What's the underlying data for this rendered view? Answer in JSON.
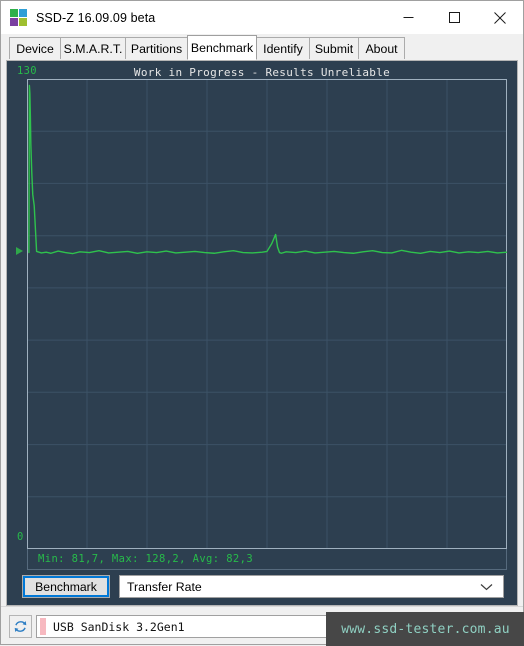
{
  "window": {
    "title": "SSD-Z 16.09.09 beta",
    "icon_name": "ssdz-app-icon",
    "icon_colors": [
      "#2fb04a",
      "#2f9fd6",
      "#7a3fa0",
      "#9fbf2f"
    ],
    "controls": {
      "minimize": "minimize-icon",
      "maximize": "maximize-icon",
      "close": "close-icon"
    }
  },
  "tabs": [
    {
      "label": "Device",
      "active": false
    },
    {
      "label": "S.M.A.R.T.",
      "active": false
    },
    {
      "label": "Partitions",
      "active": false
    },
    {
      "label": "Benchmark",
      "active": true
    },
    {
      "label": "Identify",
      "active": false
    },
    {
      "label": "Submit",
      "active": false
    },
    {
      "label": "About",
      "active": false
    }
  ],
  "benchmark": {
    "chart_title": "Work in Progress - Results Unreliable",
    "axis_max_label": "130",
    "axis_min_label": "0",
    "stats_text": "Min: 81,7, Max: 128,2, Avg: 82,3",
    "run_button_label": "Benchmark",
    "mode_select_value": "Transfer Rate",
    "mode_select_arrow": "chevron-down-icon"
  },
  "statusbar": {
    "refresh_icon": "refresh-icon",
    "device_value": "USB SanDisk 3.2Gen1",
    "device_arrow": "chevron-down-icon",
    "device_chip_color": "#f7b9c0"
  },
  "watermark": {
    "text": "www.ssd-tester.com.au"
  },
  "colors": {
    "panel_bg": "#2d3f50",
    "grid": "#3c5266",
    "plot_border": "#9fb0bf",
    "line": "#2fc24d",
    "label_green": "#27bb4a",
    "title_text": "#e6e6e6",
    "accent_focus": "#0078d7"
  },
  "chart_data": {
    "type": "line",
    "title": "Work in Progress - Results Unreliable",
    "xlabel": "",
    "ylabel": "",
    "ylim": [
      0,
      130
    ],
    "xlim": [
      0,
      100
    ],
    "grid": true,
    "grid_cols": 8,
    "grid_rows": 9,
    "ytick_labels": [
      "130",
      "0"
    ],
    "legend": null,
    "annotations": [
      "Min: 81,7, Max: 128,2, Avg: 82,3"
    ],
    "stats": {
      "min": 81.7,
      "max": 128.2,
      "avg": 82.3
    },
    "current_marker_value": 82.3,
    "series": [
      {
        "name": "Transfer Rate",
        "color": "#2fc24d",
        "x": [
          0.4,
          0.5,
          0.6,
          0.7,
          0.8,
          1.0,
          1.2,
          1.5,
          2.0,
          3.0,
          4.0,
          5.0,
          6.5,
          8.0,
          9.5,
          11.0,
          13.0,
          15.0,
          17.0,
          19.0,
          21.0,
          23.0,
          25.0,
          27.0,
          29.0,
          31.0,
          33.0,
          35.0,
          37.0,
          39.0,
          41.0,
          43.0,
          45.0,
          47.0,
          49.0,
          50.0,
          51.0,
          51.8,
          52.2,
          52.6,
          53.0,
          54.0,
          56.0,
          58.0,
          60.0,
          62.0,
          64.0,
          66.0,
          68.0,
          70.0,
          72.0,
          74.0,
          76.0,
          78.0,
          80.0,
          82.0,
          84.0,
          86.0,
          88.0,
          90.0,
          92.0,
          94.0,
          96.0,
          98.0,
          100.0
        ],
        "y": [
          82.0,
          128.2,
          126.0,
          120.0,
          112.0,
          104.0,
          98.0,
          95.0,
          82.3,
          81.9,
          82.1,
          81.8,
          82.4,
          82.0,
          81.7,
          82.2,
          82.0,
          82.5,
          81.9,
          82.1,
          82.3,
          81.8,
          82.2,
          82.0,
          82.4,
          81.9,
          82.1,
          82.3,
          82.0,
          81.8,
          82.2,
          82.5,
          82.0,
          81.9,
          82.1,
          82.3,
          84.5,
          87.0,
          83.5,
          82.0,
          81.8,
          82.2,
          82.0,
          82.4,
          81.9,
          82.1,
          82.3,
          82.0,
          81.8,
          82.2,
          82.5,
          82.0,
          81.9,
          82.6,
          82.1,
          81.8,
          82.3,
          82.0,
          82.4,
          81.9,
          82.2,
          82.0,
          82.3,
          81.9,
          82.1
        ]
      }
    ]
  }
}
